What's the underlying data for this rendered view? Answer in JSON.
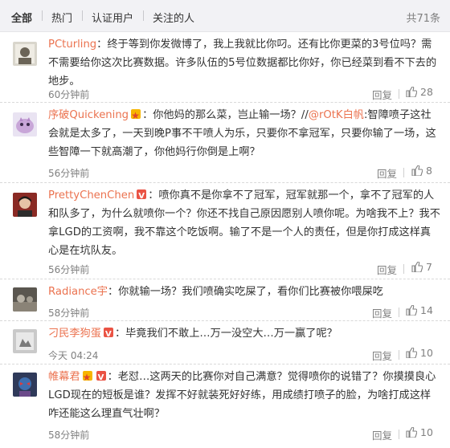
{
  "tabs": {
    "all": "全部",
    "hot": "热门",
    "verified": "认证用户",
    "following": "关注的人",
    "total": "共71条"
  },
  "comments": [
    {
      "user": "PCturling",
      "text": "：终于等到你发微博了，我上我就比你叼。还有比你更菜的3号位吗？需不需要给你这次比赛数据。许多队伍的5号位数据都比你好，你已经菜到看不下去的地步。",
      "time": "60分钟前",
      "reply": "回复",
      "likes": "28"
    },
    {
      "user": "序破Quickening",
      "text_a": "：你他妈的那么菜，岂止输一场？//",
      "mention": "@rOtK白帆",
      "text_b": ":智障喷子这社会就是太多了，一天到晚P事不干喷人为乐，只要你不拿冠军，只要你输了一场，这些智障一下就高潮了，你他妈行你倒是上啊？",
      "time": "56分钟前",
      "reply": "回复",
      "likes": "8"
    },
    {
      "user": "PrettyChenChen",
      "text": "：喷你真不是你拿不了冠军，冠军就那一个，拿不了冠军的人和队多了，为什么就喷你一个？你还不找自己原因愿别人喷你呢。为啥我不上？我不拿LGD的工资啊，我不靠这个吃饭啊。输了不是一个人的责任，但是你打成这样真心是在坑队友。",
      "time": "56分钟前",
      "reply": "回复",
      "likes": "7"
    },
    {
      "user": "Radiance宇",
      "text": "：你就输一场？我们喷确实吃屎了，看你们比赛被你喂屎吃",
      "time": "58分钟前",
      "reply": "回复",
      "likes": "14"
    },
    {
      "user": "刁民李狗蛋",
      "text": "：毕竟我们不敢上…万一没空大…万一赢了呢？",
      "time": "今天 04:24",
      "reply": "回复",
      "likes": "10"
    },
    {
      "user": "帷幕君",
      "text": "：老怼…这两天的比赛你对自己满意？觉得喷你的说错了？你摸摸良心LGD现在的短板是谁？发挥不好就装死好好练，用成绩打喷子的脸，为啥打成这样咋还能这么理直气壮啊？",
      "time": "58分钟前",
      "reply": "回复",
      "likes": "10"
    }
  ]
}
